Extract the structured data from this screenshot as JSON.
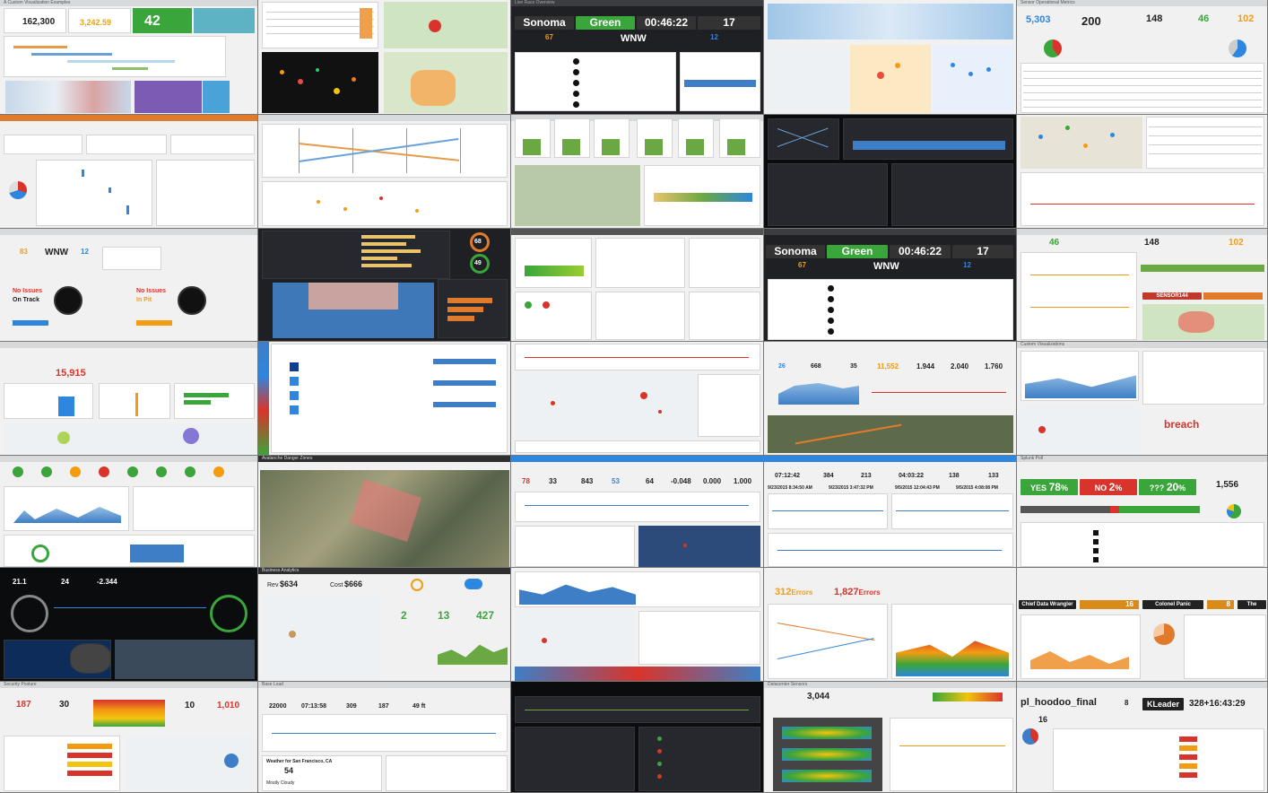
{
  "collage": {
    "top_left": {
      "title": "A Custom Visualization Examples",
      "kpi1": "162,300",
      "kpi2": "3,242.59",
      "kpi3": "42"
    },
    "race": {
      "title": "Live Race Overview",
      "track": "Sonoma",
      "status": "Green",
      "clock": "00:46:22",
      "lap": "17",
      "driver": "WNW",
      "pos": "67",
      "speed": "12"
    },
    "sensor": {
      "title": "Sensor Operational Metrics",
      "k1": "5,303",
      "k2": "200",
      "k3": "148",
      "k4": "46",
      "k5": "102"
    },
    "nascar": {
      "k1": "83",
      "driver": "WNW",
      "k2": "12",
      "status1": "No Issues",
      "status2": "On Track",
      "status3": "No Issues",
      "status4": "In Pit"
    },
    "gauges": {
      "g1": "68",
      "g2": "49"
    },
    "race2": {
      "track": "Sonoma",
      "status": "Green",
      "clock": "00:46:22",
      "lap": "17",
      "driver": "WNW",
      "pos": "67",
      "speed": "12"
    },
    "env": {
      "k1": "46",
      "k2": "148",
      "k3": "102",
      "sensor": "SENSOR144"
    },
    "row4a": {
      "kpi": "15,915"
    },
    "stats": {
      "s1": "26",
      "s2": "668",
      "s3": "35",
      "s4": "11,552",
      "s5": "1.944",
      "s6": "2.040",
      "s7": "1.760"
    },
    "custom": {
      "title": "Custom Visualizations",
      "word": "breach"
    },
    "avalanche": {
      "title": "Avalanche Danger Zones"
    },
    "tracker": {
      "k1": "78",
      "k2": "33",
      "k3": "843",
      "k4": "53",
      "k5": "64",
      "k6": "-0.048",
      "k7": "0.000",
      "k8": "1.000"
    },
    "dates": {
      "t1": "07:12:42",
      "t2": "384",
      "t3": "213",
      "t4": "04:03:22",
      "t5": "138",
      "t6": "133",
      "d1": "9/23/2015 8:34:50 AM",
      "d2": "9/23/2015 3:47:32 PM",
      "d3": "9/5/2015 12:04:43 PM",
      "d4": "9/5/2015 4:08:08 PM"
    },
    "poll": {
      "title": "Splunk Poll",
      "yes": "YES",
      "yes_pct": "78",
      "no": "NO",
      "no_pct": "2",
      "unk": "???",
      "unk_pct": "20",
      "count": "1,556"
    },
    "car": {
      "k1": "21.1",
      "k2": "24",
      "k3": "-2.344"
    },
    "biz": {
      "title": "Business Analytics",
      "rev_label": "Rev",
      "rev": "$634",
      "cost_label": "Cost",
      "cost": "$666",
      "k1": "2",
      "k2": "13",
      "k3": "427"
    },
    "errors": {
      "e1": "312",
      "e1_label": "Errors",
      "e2": "1,827",
      "e2_label": "Errors"
    },
    "leaders": {
      "c1": "Chief Data Wrangler",
      "c2": "Colonel Panic",
      "c3": "The Freeman",
      "v1": "16",
      "v2": "8"
    },
    "security": {
      "title": "Security Posture",
      "k1": "187",
      "k2": "30",
      "k3": "10",
      "k4": "1,010"
    },
    "base": {
      "title": "Base Load",
      "k1": "22000",
      "k2": "07:13:58",
      "k3": "309",
      "k4": "187",
      "k5": "49 ft",
      "weather": "Weather for San Francisco, CA",
      "temp": "54",
      "cond": "Mostly Cloudy"
    },
    "floor": {
      "title": "Datacenter Sensors",
      "k1": "3,044"
    },
    "hoodoo": {
      "name": "pl_hoodoo_final",
      "rank": "8",
      "leader_label": "KLeader",
      "leader_val": "328+16:43:29",
      "k1": "16"
    }
  },
  "colors": {
    "green": "#3aa53a",
    "orange": "#f39c12",
    "red": "#d9342b",
    "blue": "#2e86de",
    "dark_bg": "#1e2024"
  }
}
